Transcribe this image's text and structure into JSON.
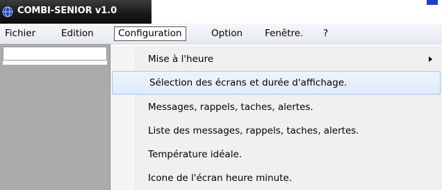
{
  "window": {
    "title": "COMBI-SENIOR v1.0",
    "icon": "globe-icon"
  },
  "menubar": {
    "items": [
      {
        "label": "Fichier"
      },
      {
        "label": "Edition"
      },
      {
        "label": "Configuration",
        "active": true
      },
      {
        "label": "Option"
      },
      {
        "label": "Fenêtre."
      },
      {
        "label": "?"
      }
    ]
  },
  "configuration_menu": {
    "items": [
      {
        "label": "Mise à l'heure",
        "submenu": true
      },
      {
        "label": "Sélection des écrans et durée d'affichage.",
        "highlighted": true
      },
      {
        "label": "Messages, rappels, taches, alertes."
      },
      {
        "label": "Liste des messages, rappels, taches, alertes."
      },
      {
        "label": "Température idéale."
      },
      {
        "label": "Icone de l'écran heure minute."
      }
    ]
  },
  "colors": {
    "highlight": "#dfeaf9",
    "highlight_border": "#a9c7ee",
    "side_panel": "#ababab",
    "title_bar": "#1a1a1a"
  }
}
